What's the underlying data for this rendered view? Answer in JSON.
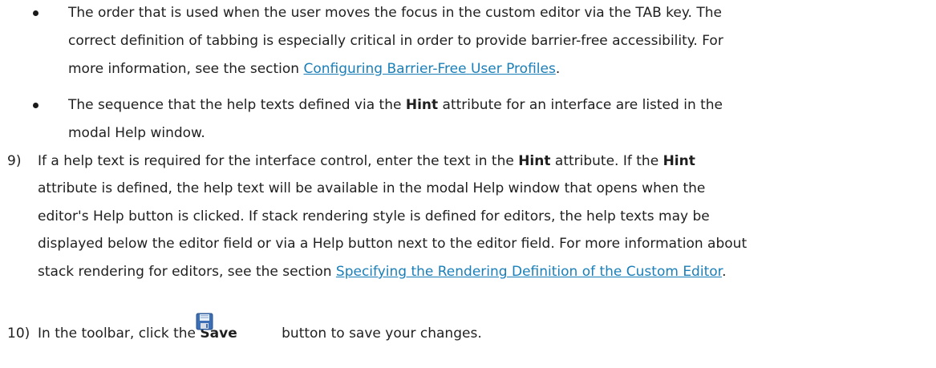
{
  "bullet1": {
    "line1": "The order that is used when the user moves the focus in the custom editor via the TAB key. The",
    "line2": "correct definition of tabbing is especially critical in order to provide barrier-free accessibility. For",
    "line3_pre": "more information, see the section ",
    "line3_link": "Configuring Barrier-Free User Profiles",
    "line3_post": "."
  },
  "bullet2": {
    "line1_pre": "The sequence that the help texts defined via the ",
    "line1_bold": "Hint",
    "line1_post": " attribute for an interface are listed in the",
    "line2": "modal Help window."
  },
  "step9": {
    "number": "9)",
    "line1_pre": "If a help text is required for the interface control, enter the text in the ",
    "line1_bold1": "Hint",
    "line1_mid": " attribute. If the ",
    "line1_bold2": "Hint",
    "line2": "attribute is defined, the help text will be available in the modal Help window that opens when the",
    "line3": "editor's Help button is clicked. If stack rendering style is defined for editors, the help texts may be",
    "line4": "displayed below the editor field or via a Help button next to the editor field. For more information about",
    "line5_pre": "stack rendering for editors, see the section ",
    "line5_link": "Specifying the Rendering Definition of the Custom Editor",
    "line5_post": "."
  },
  "step10": {
    "number": "10)",
    "pre": "In the toolbar, click the ",
    "bold": "Save",
    "post": " button to save your changes.",
    "icon": "floppy-disk-save-icon"
  }
}
